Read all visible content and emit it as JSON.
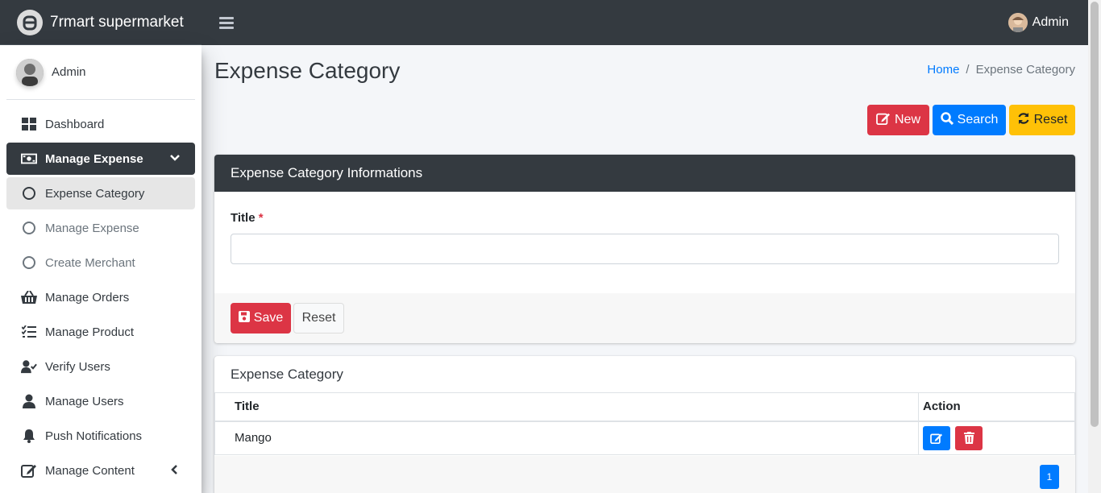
{
  "app": {
    "title": "7rmart supermarket"
  },
  "topbar": {
    "user": "Admin"
  },
  "sidebar": {
    "user": "Admin",
    "items": [
      {
        "label": "Dashboard",
        "icon": "dashboard-icon"
      },
      {
        "label": "Manage Expense",
        "icon": "money-icon"
      },
      {
        "label": "Expense Category",
        "icon": "circle-icon"
      },
      {
        "label": "Manage Expense",
        "icon": "circle-icon"
      },
      {
        "label": "Create Merchant",
        "icon": "circle-icon"
      },
      {
        "label": "Manage Orders",
        "icon": "basket-icon"
      },
      {
        "label": "Manage Product",
        "icon": "list-check-icon"
      },
      {
        "label": "Verify Users",
        "icon": "user-check-icon"
      },
      {
        "label": "Manage Users",
        "icon": "user-icon"
      },
      {
        "label": "Push Notifications",
        "icon": "bell-icon"
      },
      {
        "label": "Manage Content",
        "icon": "edit-icon"
      }
    ]
  },
  "page": {
    "title": "Expense Category",
    "breadcrumb": {
      "home": "Home",
      "sep": "/",
      "current": "Expense Category"
    }
  },
  "actions": {
    "new": "New",
    "search": "Search",
    "reset": "Reset"
  },
  "form": {
    "header": "Expense Category Informations",
    "title_label": "Title",
    "required_mark": "*",
    "title_value": "",
    "save": "Save",
    "reset": "Reset"
  },
  "list": {
    "header": "Expense Category",
    "columns": [
      "Title",
      "Action"
    ],
    "rows": [
      {
        "title": "Mango"
      }
    ],
    "pagination": [
      "1"
    ]
  },
  "colors": {
    "dark": "#343a40",
    "danger": "#dc3545",
    "primary": "#007bff",
    "warning": "#ffc107"
  }
}
